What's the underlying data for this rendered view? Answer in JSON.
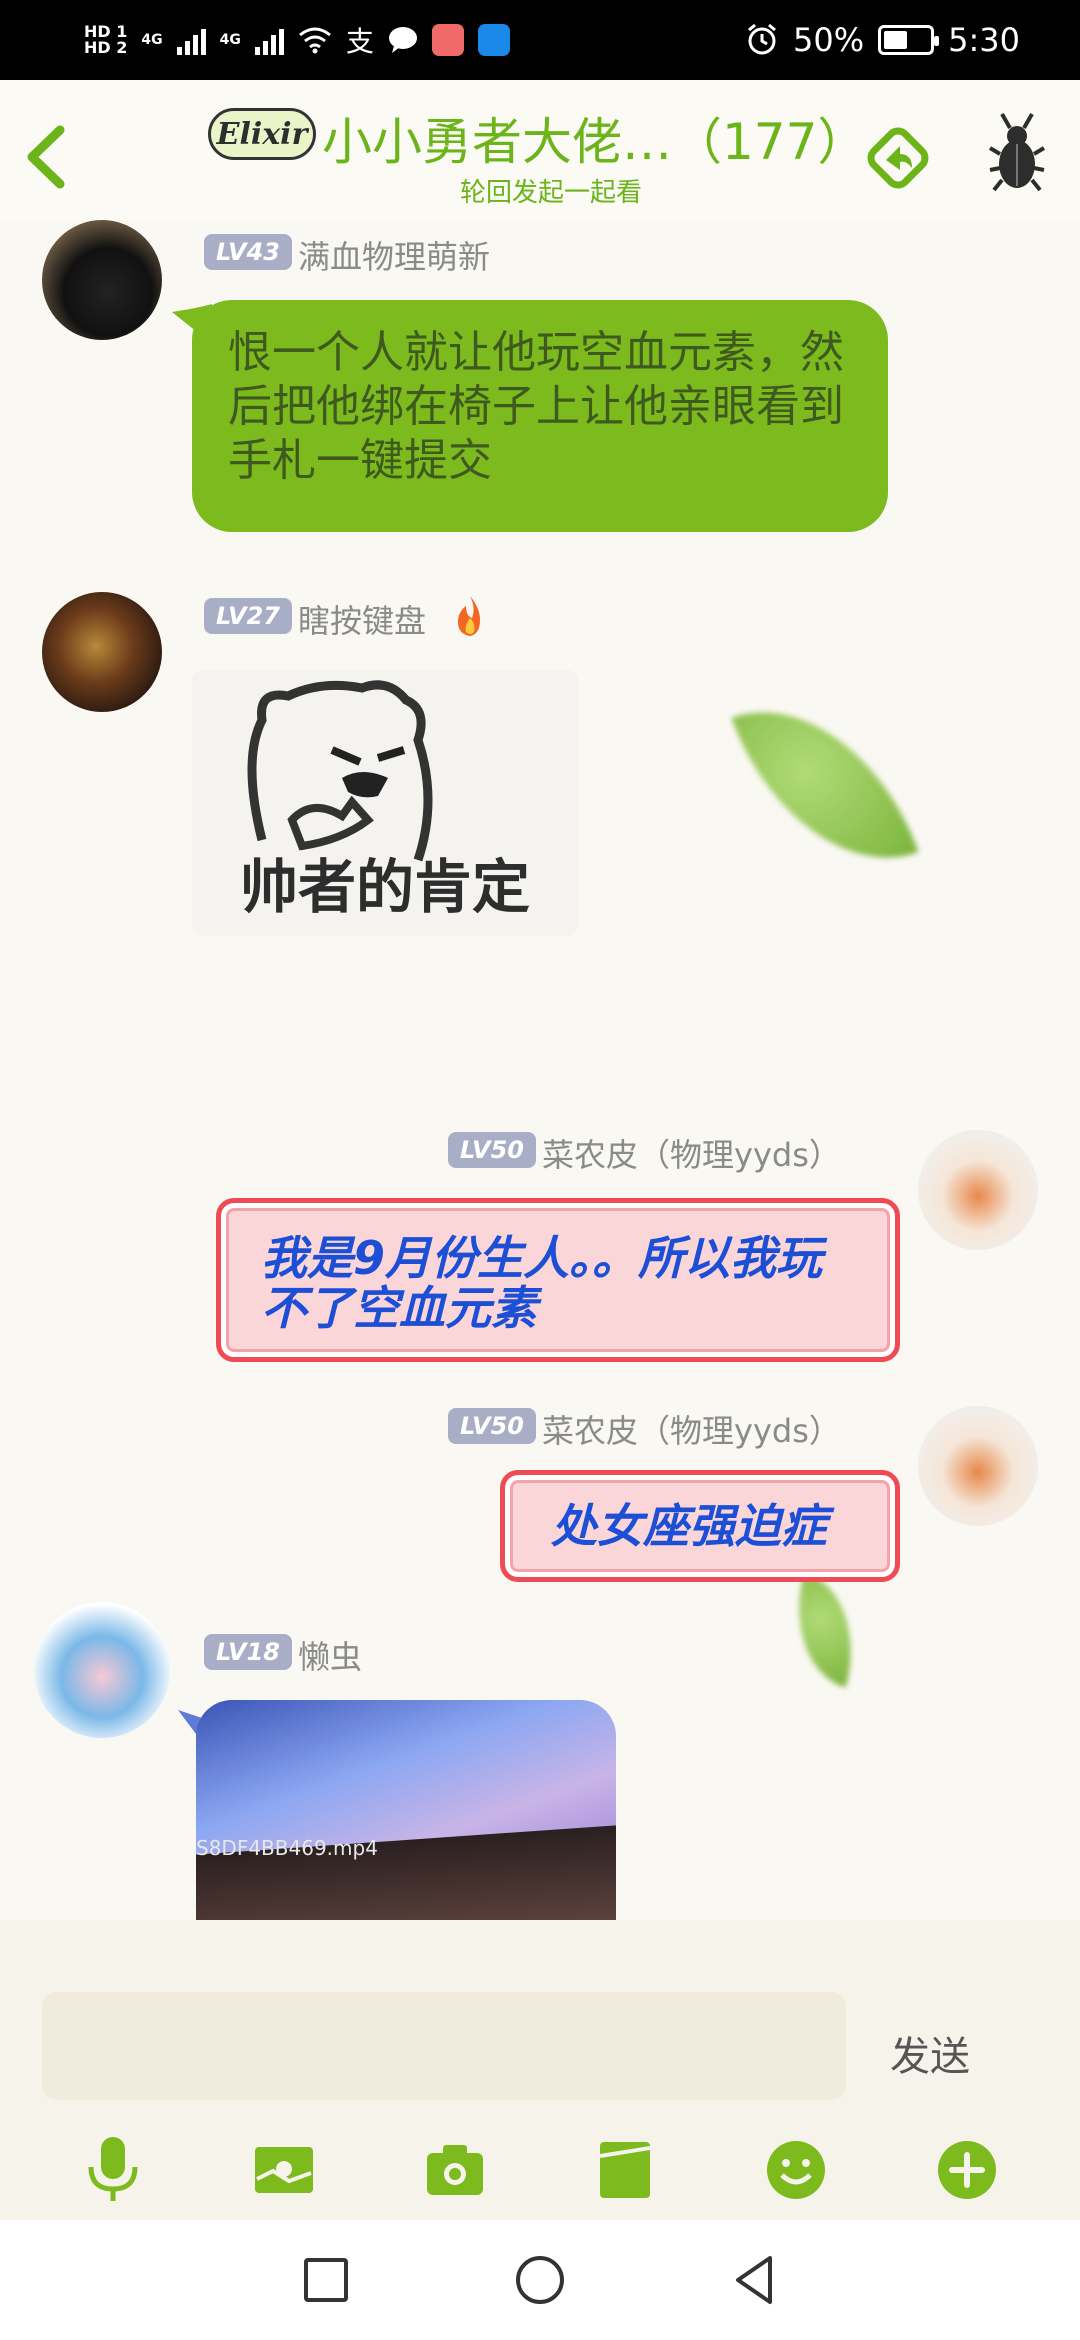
{
  "status_bar": {
    "hd_top": "HD 1",
    "hd_bottom": "HD 2",
    "network_1": "4G",
    "network_2": "4G",
    "battery_percent": "50%",
    "time": "5:30"
  },
  "header": {
    "logo_text": "Elixir",
    "title": "小小勇者大佬…（177）",
    "subtitle": "轮回发起一起看"
  },
  "messages": [
    {
      "level": "LV43",
      "name": "满血物理萌新",
      "text": "恨一个人就让他玩空血元素，然后把他绑在椅子上让他亲眼看到手札一键提交",
      "side": "left"
    },
    {
      "level": "LV27",
      "name": "瞎按键盘",
      "badge_icon": "fire-icon",
      "sticker_caption": "帅者的肯定",
      "side": "left"
    },
    {
      "level": "LV50",
      "name": "菜农皮（物理yyds）",
      "text": "我是9月份生人。。所以我玩不了空血元素",
      "side": "right"
    },
    {
      "level": "LV50",
      "name": "菜农皮（物理yyds）",
      "text": "处女座强迫症",
      "side": "right"
    },
    {
      "level": "LV18",
      "name": "懒虫",
      "video_filename": "S8DF4BB469.mp4",
      "side": "left"
    }
  ],
  "input": {
    "value": "",
    "send_label": "发送"
  },
  "toolbar": [
    "mic-icon",
    "image-icon",
    "camera-icon",
    "card-icon",
    "emoji-icon",
    "plus-icon"
  ],
  "colors": {
    "accent_green": "#6bb51a",
    "bubble_green": "#7cba1e",
    "bubble_pink_border": "#ee4b54",
    "bubble_pink_fill": "#fbd6d8",
    "pink_text": "#1d4fd6",
    "level_badge": "#a9aec7"
  }
}
